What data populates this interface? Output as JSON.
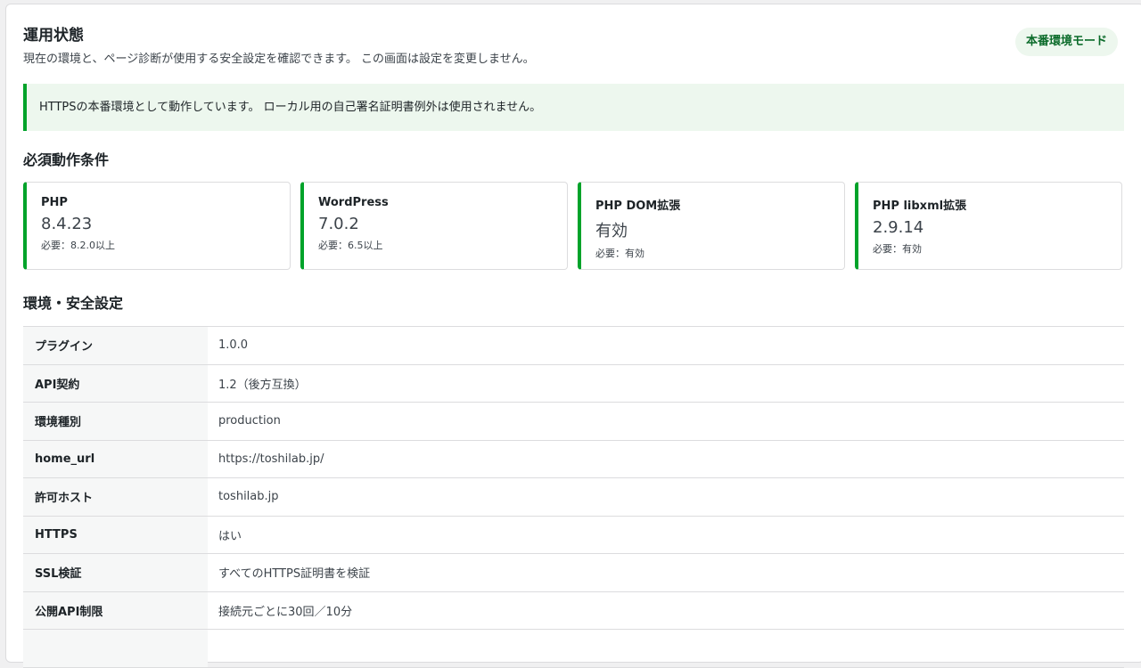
{
  "header": {
    "title": "運用状態",
    "description": "現在の環境と、ページ診断が使用する安全設定を確認できます。 この画面は設定を変更しません。",
    "mode_badge": "本番環境モード"
  },
  "notice": {
    "text": "HTTPSの本番環境として動作しています。 ローカル用の自己署名証明書例外は使用されません。",
    "color": "#00a32a"
  },
  "requirements": {
    "title": "必須動作条件",
    "items": [
      {
        "name": "PHP",
        "value": "8.4.23",
        "need": "必要：8.2.0以上"
      },
      {
        "name": "WordPress",
        "value": "7.0.2",
        "need": "必要：6.5以上"
      },
      {
        "name": "PHP DOM拡張",
        "value": "有効",
        "need": "必要：有効"
      },
      {
        "name": "PHP libxml拡張",
        "value": "2.9.14",
        "need": "必要：有効"
      }
    ]
  },
  "environment": {
    "title": "環境・安全設定",
    "rows": [
      {
        "label": "プラグイン",
        "value": "1.0.0"
      },
      {
        "label": "API契約",
        "value": "1.2（後方互換）"
      },
      {
        "label": "環境種別",
        "value": "production"
      },
      {
        "label": "home_url",
        "value": "https://toshilab.jp/"
      },
      {
        "label": "許可ホスト",
        "value": "toshilab.jp"
      },
      {
        "label": "HTTPS",
        "value": "はい"
      },
      {
        "label": "SSL検証",
        "value": "すべてのHTTPS証明書を検証"
      },
      {
        "label": "公開API制限",
        "value": "接続元ごとに30回／10分"
      },
      {
        "label": "",
        "value": ""
      }
    ]
  }
}
